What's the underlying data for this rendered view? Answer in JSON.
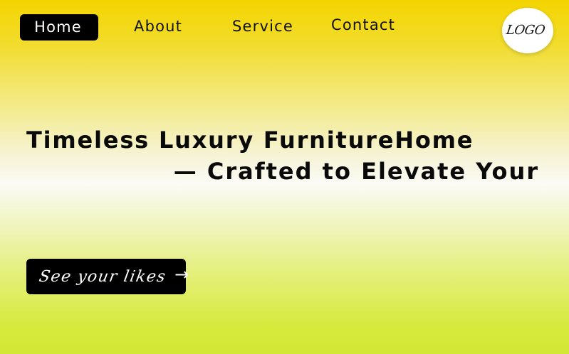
{
  "nav": {
    "items": [
      {
        "label": "Home",
        "active": true
      },
      {
        "label": "About",
        "active": false
      },
      {
        "label": "Service",
        "active": false
      },
      {
        "label": "Contact",
        "active": false
      }
    ]
  },
  "logo": {
    "text": "LOGO"
  },
  "hero": {
    "headline_line1": "Timeless Luxury FurnitureHome",
    "headline_line2": "— Crafted to Elevate Your",
    "cta_label": "See your likes",
    "cta_arrow": "→"
  },
  "colors": {
    "gradient_top": "#f4d400",
    "gradient_middle": "#fbfbf6",
    "gradient_bottom": "#d2e834",
    "button_bg": "#000000",
    "button_text": "#ffffff",
    "heading_text": "#0a0a0a"
  },
  "icons": {
    "cta_arrow": "arrow-right-icon"
  }
}
